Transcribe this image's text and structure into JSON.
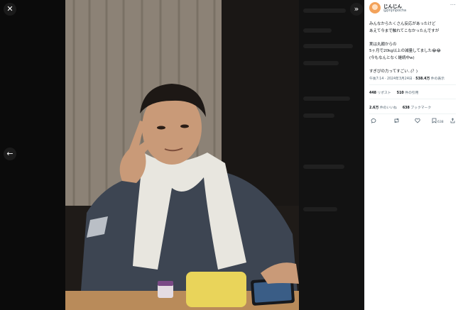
{
  "viewer": {
    "close_icon": "✕",
    "prev_icon": "←",
    "expand_icon": "»"
  },
  "tweet": {
    "display_name": "じんじん",
    "handle": "@jinjinpocha",
    "more_icon": "···",
    "lines": [
      "みんなからたくさん反応があったけど",
      "あえて今まで触れてこなかったんですが",
      "",
      "実は丸顔からの",
      "5ヶ月で20kg以上の減量してました😂😂",
      "(今もなんとなく継続中w)",
      "",
      "すぎぴの力ってすごい..(？)"
    ],
    "time": "午後7:14 · 2024年3月24日 · ",
    "views_count": "538.4万",
    "views_label": " 件の表示",
    "reposts_count": "448",
    "reposts_label": " リポスト",
    "quotes_count": "510",
    "quotes_label": " 件の引用",
    "likes_count": "2.6万",
    "likes_label": " 件のいいね",
    "bookmarks_count": "638",
    "bookmarks_label": " ブックマーク",
    "bookmark_action_count": "638"
  },
  "colors": {
    "panel_bg": "#ffffff",
    "text": "#0f1419",
    "muted": "#536471",
    "viewer_bg": "#0a0a0a"
  }
}
